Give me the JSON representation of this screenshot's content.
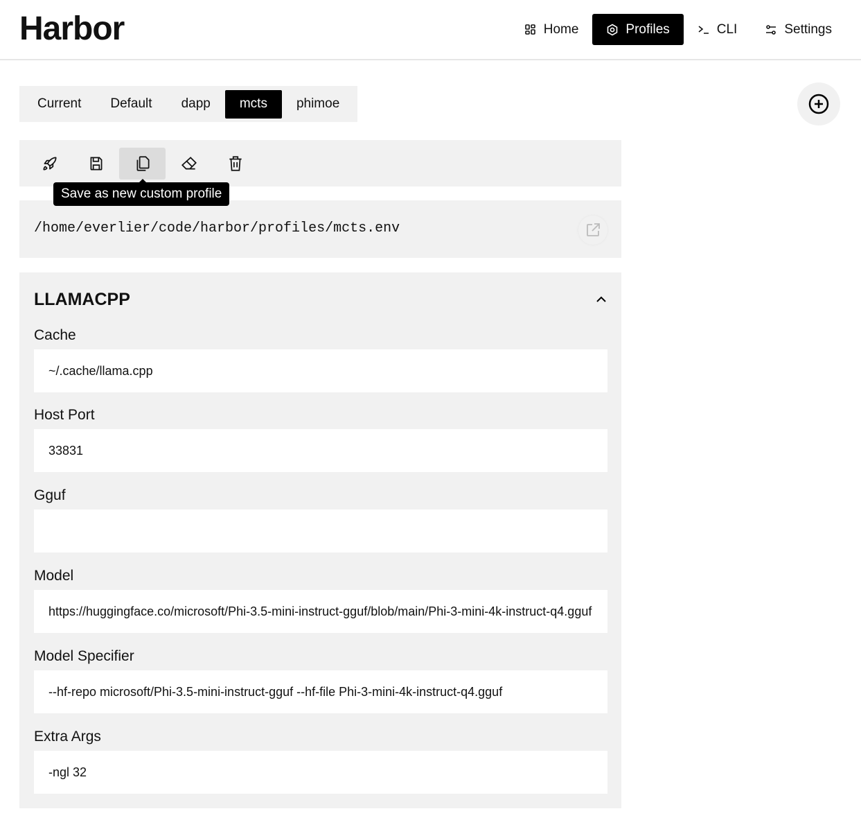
{
  "app": {
    "title": "Harbor"
  },
  "nav": [
    {
      "label": "Home",
      "icon": "grid-icon"
    },
    {
      "label": "Profiles",
      "icon": "hexagon-icon",
      "active": true
    },
    {
      "label": "CLI",
      "icon": "terminal-icon"
    },
    {
      "label": "Settings",
      "icon": "sliders-icon"
    }
  ],
  "tabs": [
    {
      "label": "Current"
    },
    {
      "label": "Default"
    },
    {
      "label": "dapp"
    },
    {
      "label": "mcts",
      "active": true
    },
    {
      "label": "phimoe"
    }
  ],
  "toolbar": {
    "tooltip": "Save as new custom profile"
  },
  "profile": {
    "path": "/home/everlier/code/harbor/profiles/mcts.env"
  },
  "section": {
    "title": "LLAMACPP",
    "fields": [
      {
        "label": "Cache",
        "value": "~/.cache/llama.cpp"
      },
      {
        "label": "Host Port",
        "value": "33831"
      },
      {
        "label": "Gguf",
        "value": ""
      },
      {
        "label": "Model",
        "value": "https://huggingface.co/microsoft/Phi-3.5-mini-instruct-gguf/blob/main/Phi-3-mini-4k-instruct-q4.gguf"
      },
      {
        "label": "Model Specifier",
        "value": "--hf-repo microsoft/Phi-3.5-mini-instruct-gguf --hf-file Phi-3-mini-4k-instruct-q4.gguf"
      },
      {
        "label": "Extra Args",
        "value": "-ngl 32"
      }
    ]
  }
}
